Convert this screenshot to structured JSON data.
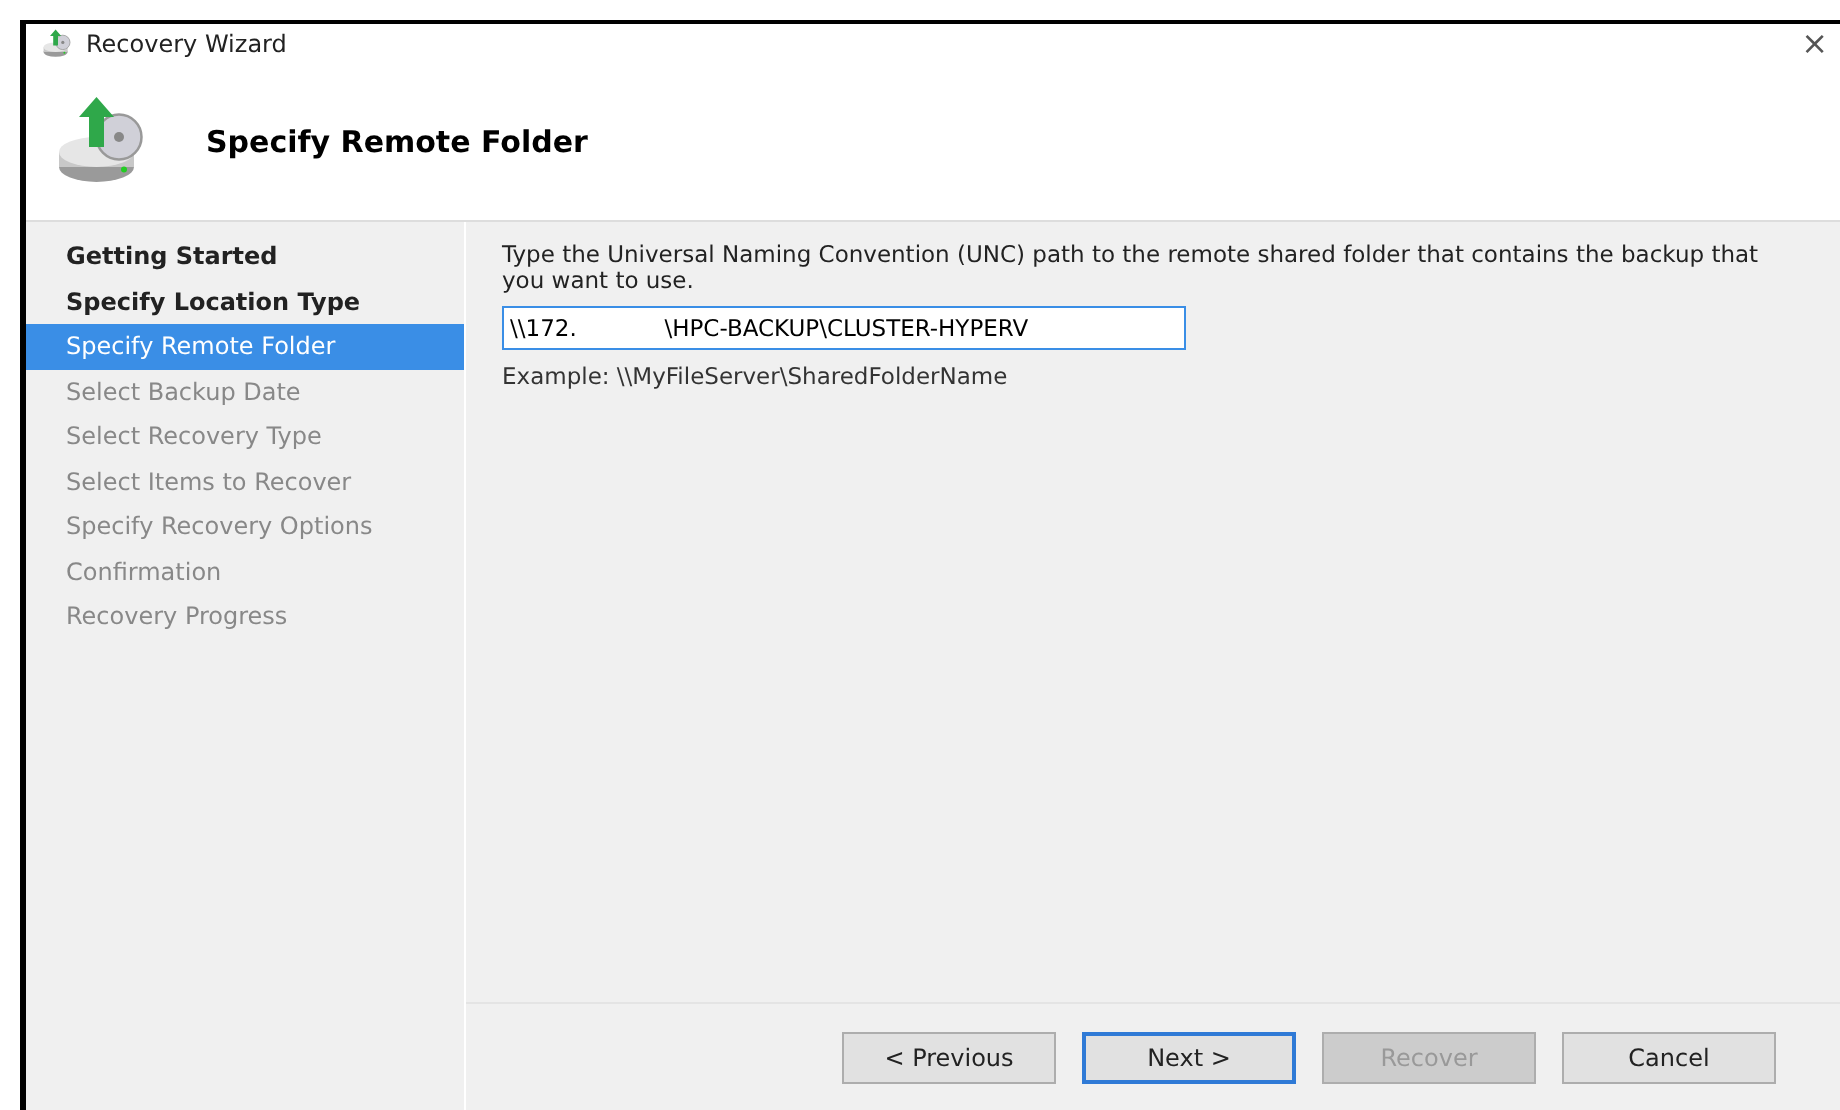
{
  "window": {
    "title": "Recovery Wizard",
    "close": "×"
  },
  "header": {
    "title": "Specify Remote Folder"
  },
  "steps": [
    {
      "label": "Getting Started",
      "completed": true,
      "selected": false
    },
    {
      "label": "Specify Location Type",
      "completed": true,
      "selected": false
    },
    {
      "label": "Specify Remote Folder",
      "completed": false,
      "selected": true
    },
    {
      "label": "Select Backup Date",
      "completed": false,
      "selected": false
    },
    {
      "label": "Select Recovery Type",
      "completed": false,
      "selected": false
    },
    {
      "label": "Select Items to Recover",
      "completed": false,
      "selected": false
    },
    {
      "label": "Specify Recovery Options",
      "completed": false,
      "selected": false
    },
    {
      "label": "Confirmation",
      "completed": false,
      "selected": false
    },
    {
      "label": "Recovery Progress",
      "completed": false,
      "selected": false
    }
  ],
  "content": {
    "instruction": "Type the Universal Naming Convention (UNC) path to the remote shared folder that contains the backup that you want to use.",
    "path": {
      "value": "\\\\172.            \\HPC-BACKUP\\CLUSTER-HYPERV",
      "focused": true
    },
    "example": "Example: \\\\MyFileServer\\SharedFolderName"
  },
  "buttons": [
    {
      "label": "< Previous",
      "disabled": false,
      "default": false
    },
    {
      "label": "Next >",
      "disabled": false,
      "default": true
    },
    {
      "label": "Recover",
      "disabled": true,
      "default": false
    },
    {
      "label": "Cancel",
      "disabled": false,
      "default": false
    }
  ]
}
